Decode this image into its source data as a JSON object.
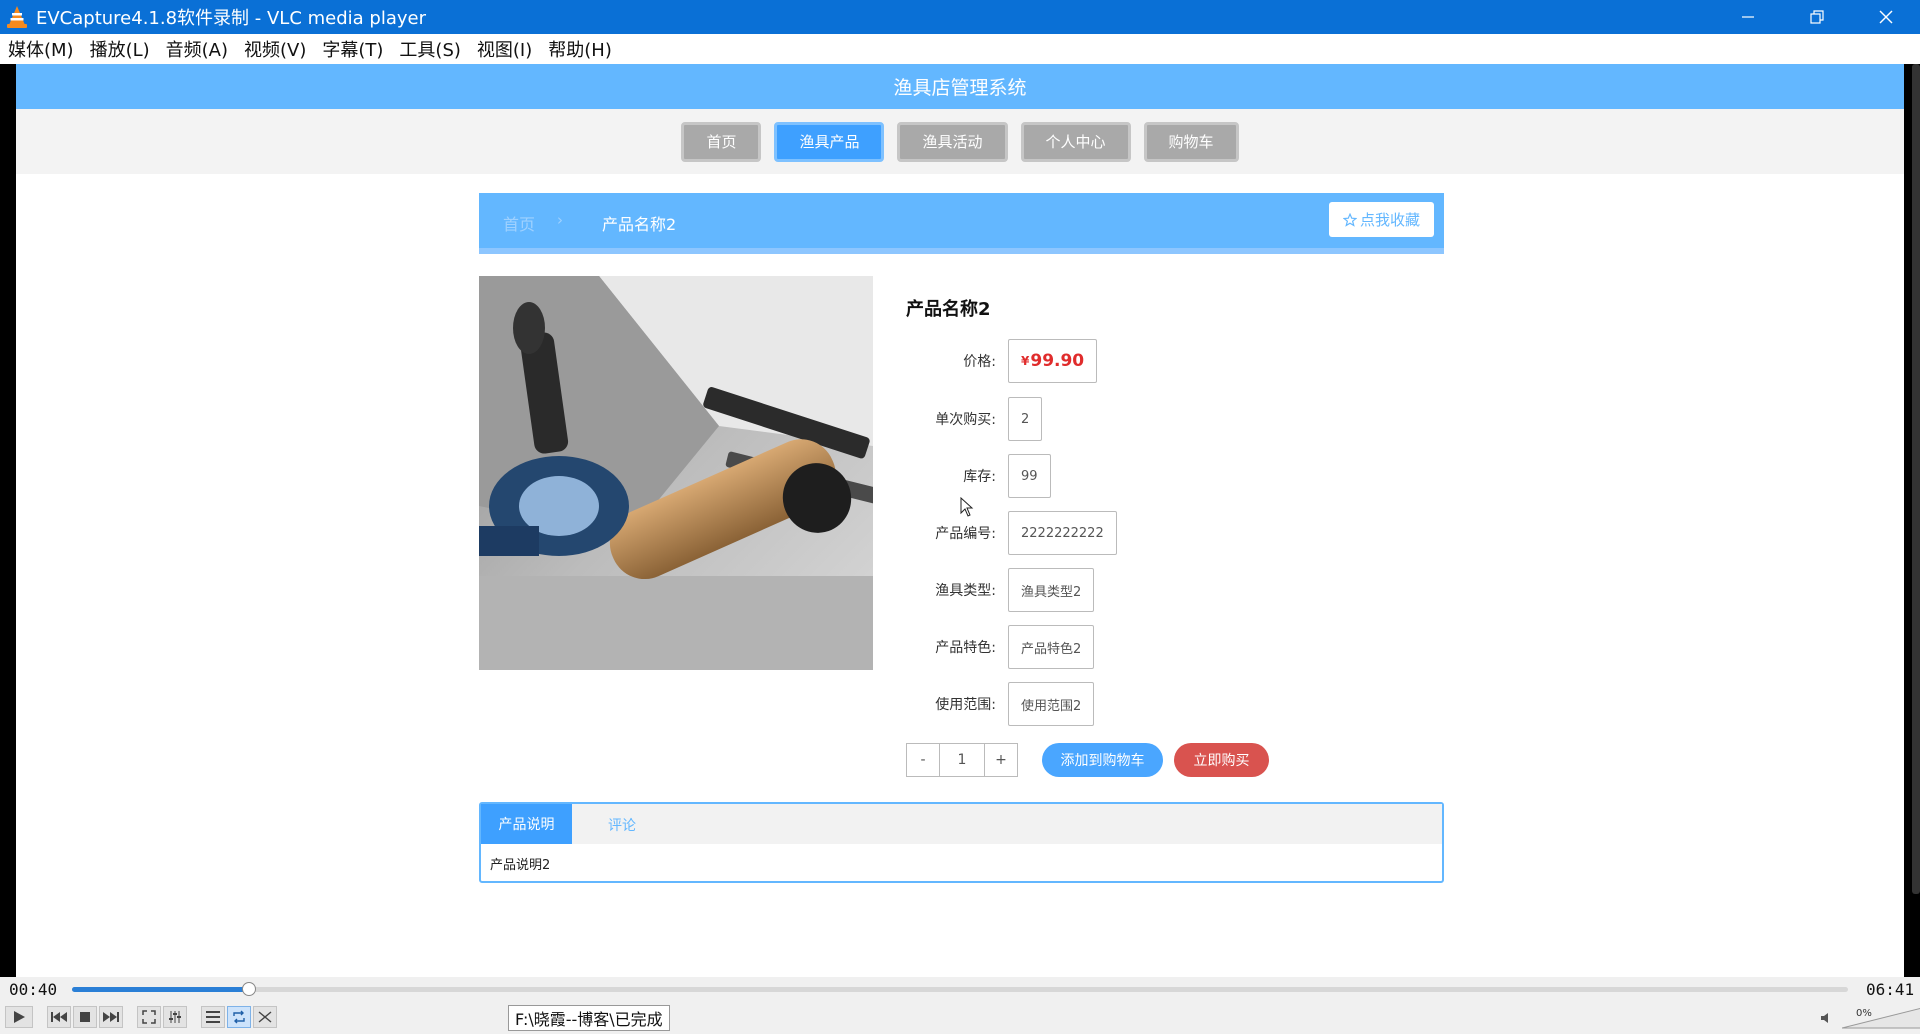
{
  "window": {
    "title": "EVCapture4.1.8软件录制 - VLC media player"
  },
  "menu": [
    "媒体(M)",
    "播放(L)",
    "音频(A)",
    "视频(V)",
    "字幕(T)",
    "工具(S)",
    "视图(I)",
    "帮助(H)"
  ],
  "site": {
    "header_title": "渔具店管理系统",
    "nav": [
      "首页",
      "渔具产品",
      "渔具活动",
      "个人中心",
      "购物车"
    ],
    "nav_active_index": 1
  },
  "breadcrumb": {
    "home": "首页",
    "separator": "›",
    "current": "产品名称2",
    "favorite_label": "点我收藏"
  },
  "product": {
    "name": "产品名称2",
    "fields": [
      {
        "label": "价格:",
        "currency": "¥",
        "value": "99.90"
      },
      {
        "label": "单次购买:",
        "value": "2"
      },
      {
        "label": "库存:",
        "value": "99"
      },
      {
        "label": "产品编号:",
        "value": "2222222222"
      },
      {
        "label": "渔具类型:",
        "value": "渔具类型2"
      },
      {
        "label": "产品特色:",
        "value": "产品特色2"
      },
      {
        "label": "使用范围:",
        "value": "使用范围2"
      }
    ],
    "quantity": {
      "minus": "-",
      "value": "1",
      "plus": "+"
    },
    "add_to_cart": "添加到购物车",
    "buy_now": "立即购买"
  },
  "tabs": {
    "tab1": "产品说明",
    "tab2": "评论",
    "content": "产品说明2"
  },
  "player": {
    "elapsed": "00:40",
    "total": "06:41",
    "progress_fraction": 0.0998,
    "status": "F:\\晓霞--博客\\已完成",
    "volume": "0%"
  },
  "colors": {
    "titlebar": "#0a70d6",
    "site_blue": "#63b7ff",
    "active_blue": "#3ea0ff",
    "price_red": "#e02c2c",
    "buy_red": "#d9534f"
  }
}
